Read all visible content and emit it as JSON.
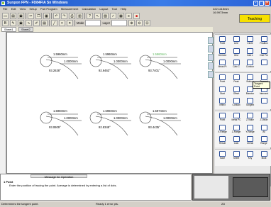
{
  "app": {
    "title": "Sunpon FPN - FD84FIA Sn Windows"
  },
  "menu": [
    "File",
    "Edit",
    "View",
    "Setup",
    "Part Program",
    "Measurement",
    "Calculation",
    "Layout",
    "Tool",
    "Help"
  ],
  "coords": {
    "line1": "222.1115mm",
    "line2": "16.9973mm"
  },
  "mode_badge": "Teaching",
  "toolbar": {
    "zoom_label": "Mode",
    "layer_label": "Layer"
  },
  "tabs": [
    "Sheet1",
    "Sheet2"
  ],
  "arcs": [
    {
      "distance": "1.5960mm",
      "radius": "1.0000mm",
      "angle": "93.2638°"
    },
    {
      "distance": "1.5960mm",
      "radius": "1.0000mm",
      "angle": "92.9463°"
    },
    {
      "distance": "1.5960mm",
      "radius": "1.0000mm",
      "angle": "93.7401°"
    },
    {
      "distance": "1.5960mm",
      "radius": "1.0000mm",
      "angle": "93.0609°"
    },
    {
      "distance": "1.5960mm",
      "radius": "1.0000mm",
      "angle": "92.8348°"
    },
    {
      "distance": "1.5974mm",
      "radius": "1.0000mm",
      "angle": "93.4435°"
    }
  ],
  "panel": {
    "g1": [
      "Point",
      "Line",
      "Circle",
      "Position",
      "Derived",
      "Dist",
      "Calc L",
      "Dist Pnt",
      "Meas Pt",
      "Calc C",
      "Contour",
      ""
    ],
    "g2": [
      "Point",
      "Peak",
      "Bottom",
      "Tangent",
      "Start",
      "Offset",
      "Bisector",
      "Intersect",
      "Inflect",
      "Contact",
      "Tangent",
      ""
    ],
    "g3": [
      "Point",
      "Meas PC",
      "Z-Value",
      "Z-Value",
      "X-Range",
      "Z-Range",
      "Y-Range",
      "All",
      "Result",
      "Calc",
      "Check",
      "Range"
    ],
    "g4": [
      "Save",
      "Sheet",
      "Key",
      "Multi"
    ],
    "tooltip": "Tangent Point"
  },
  "message": {
    "title": "Message for Operation",
    "item": "1 Point",
    "text": "Enter the position of tracing the point. Average is determined by entering a list of dots."
  },
  "status": {
    "left": "Determines the tangent point.",
    "mid": "Ready  1 error pts.",
    "right": "2D"
  }
}
